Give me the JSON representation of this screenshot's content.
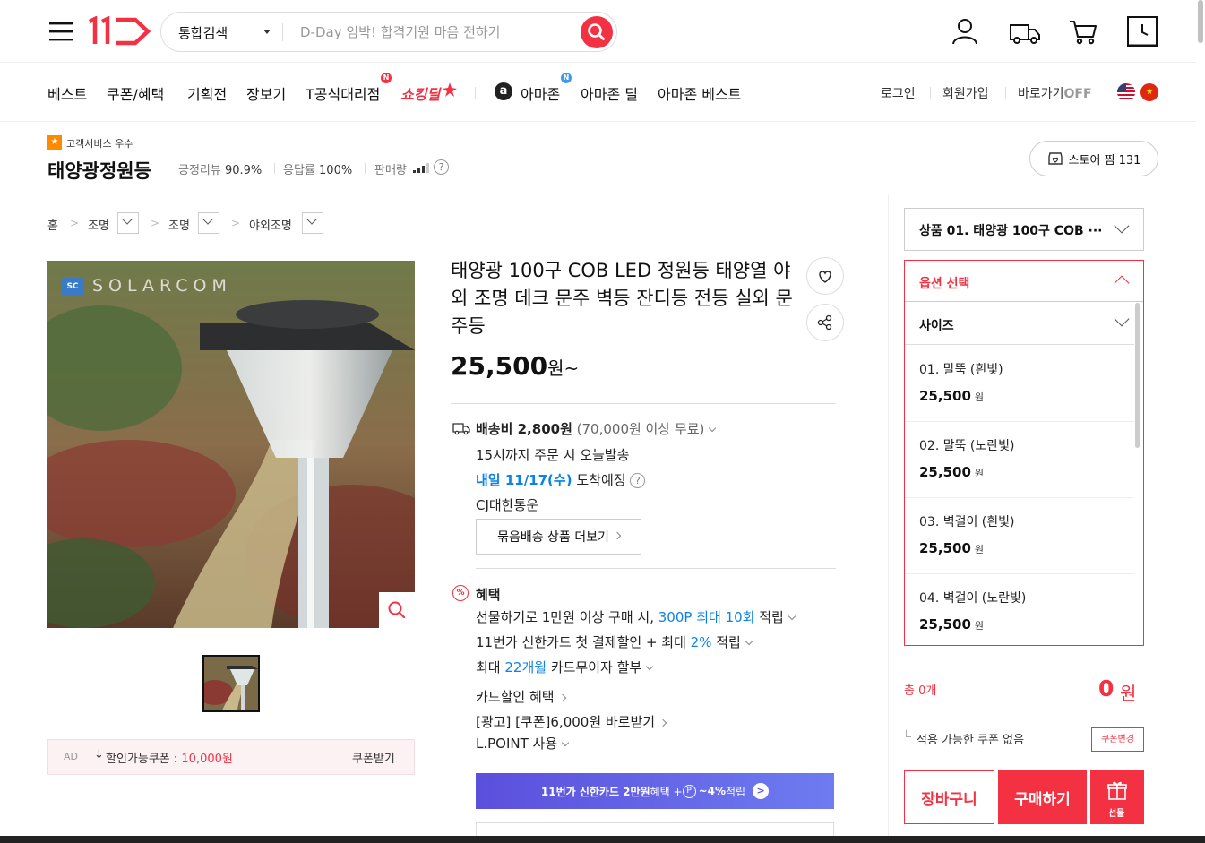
{
  "header": {
    "search_category": "통합검색",
    "search_placeholder": "D-Day 임박! 합격기원 마음 전하기"
  },
  "gnb": {
    "left": [
      "베스트",
      "쿠폰/혜택",
      "기획전",
      "장보기",
      "T공식대리점"
    ],
    "shopping_deal": "쇼킹딜",
    "amazon": "아마존",
    "amazon_deal": "아마존 딜",
    "amazon_best": "아마존 베스트",
    "badge": "N",
    "login": "로그인",
    "signup": "회원가입",
    "shortcut": "바로가기",
    "shortcut_state": "OFF"
  },
  "seller": {
    "badge": "고객서비스 우수",
    "name": "태양광정원등",
    "review_label": "긍정리뷰",
    "review_value": "90.9%",
    "response_label": "응답률",
    "response_value": "100%",
    "sales_label": "판매량",
    "store_zzim": "스토어 찜 131"
  },
  "breadcrumb": [
    "홈",
    "조명",
    "조명",
    "야외조명"
  ],
  "product": {
    "image_watermark": "SOLARCOM",
    "image_logo": "SC",
    "title": "태양광 100구 COB LED 정원등 태양열 야외 조명 데크 문주 벽등 잔디등 전등 실외 문주등",
    "price": "25,500",
    "price_unit": "원~"
  },
  "coupon_ad": {
    "ad": "AD",
    "label": "할인가능쿠폰 : ",
    "amount": "10,000원",
    "button": "쿠폰받기"
  },
  "delivery": {
    "label": "배송비 2,800원",
    "free": "(70,000원 이상 무료)",
    "today": "15시까지 주문 시 오늘발송",
    "arrival_date": "내일 11/17(수)",
    "arrival_label": "도착예정",
    "courier": "CJ대한통운",
    "bundle_button": "묶음배송 상품 더보기"
  },
  "benefit": {
    "title": "혜택",
    "line1_a": "선물하기로 1만원 이상 구매 시, ",
    "line1_b": "300P 최대 10회",
    "line1_c": " 적립",
    "line2_a": "11번가 신한카드 첫 결제할인 + 최대 ",
    "line2_b": "2%",
    "line2_c": " 적립",
    "line3_a": "최대 ",
    "line3_b": "22개월",
    "line3_c": " 카드무이자 할부",
    "card_discount": "카드할인 혜택",
    "ad_coupon": "[광고] [쿠폰]6,000원 바로받기",
    "lpoint": "L.POINT 사용",
    "banner_a": "11번가 신한카드 2만원",
    "banner_b": " 혜택 + ",
    "banner_c": "~4%",
    "banner_d": " 적립"
  },
  "order": {
    "product_select": "상품 01. 태양광 100구 COB ···",
    "option_title": "옵션 선택",
    "size_label": "사이즈",
    "options": [
      {
        "name": "01. 말뚝 (흰빛)",
        "price": "25,500",
        "unit": "원"
      },
      {
        "name": "02. 말뚝 (노란빛)",
        "price": "25,500",
        "unit": "원"
      },
      {
        "name": "03. 벽걸이 (흰빛)",
        "price": "25,500",
        "unit": "원"
      },
      {
        "name": "04. 벽걸이 (노란빛)",
        "price": "25,500",
        "unit": "원"
      }
    ],
    "total_label": "총 0개",
    "total_amount": "0",
    "total_unit": "원",
    "coupon_none": "적용 가능한 쿠폰 없음",
    "coupon_change": "쿠폰변경",
    "cart": "장바구니",
    "buy": "구매하기",
    "gift": "선물"
  }
}
